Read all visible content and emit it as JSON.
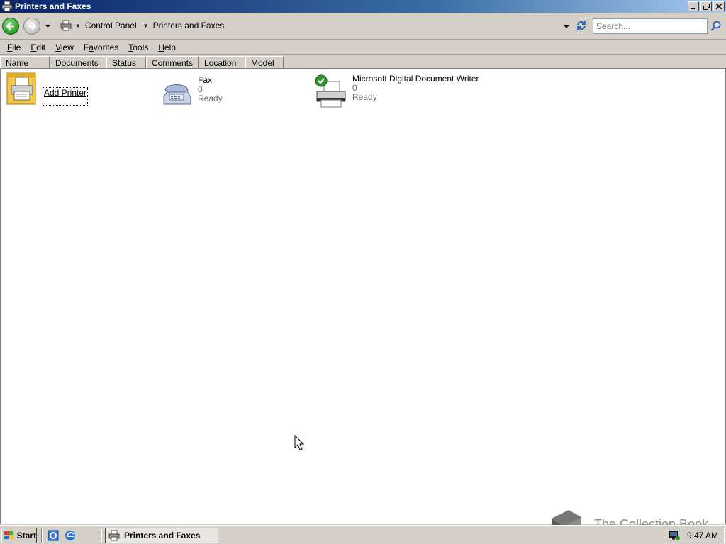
{
  "window": {
    "title": "Printers and Faxes"
  },
  "address": {
    "breadcrumbs": [
      "Control Panel",
      "Printers and Faxes"
    ],
    "search_placeholder": "Search..."
  },
  "menu": [
    {
      "pre": "",
      "ul": "F",
      "post": "ile"
    },
    {
      "pre": "",
      "ul": "E",
      "post": "dit"
    },
    {
      "pre": "",
      "ul": "V",
      "post": "iew"
    },
    {
      "pre": "F",
      "ul": "a",
      "post": "vorites"
    },
    {
      "pre": "",
      "ul": "T",
      "post": "ools"
    },
    {
      "pre": "",
      "ul": "H",
      "post": "elp"
    }
  ],
  "columns": [
    "Name",
    "Documents",
    "Status",
    "Comments",
    "Location",
    "Model"
  ],
  "items": {
    "add_printer": {
      "label": "Add Printer"
    },
    "fax": {
      "name": "Fax",
      "documents": "0",
      "status": "Ready"
    },
    "mddw": {
      "name": "Microsoft Digital Document Writer",
      "documents": "0",
      "status": "Ready",
      "is_default": true
    }
  },
  "taskbar": {
    "start_label": "Start",
    "task_label": "Printers and Faxes",
    "clock": "9:47 AM"
  },
  "watermark": {
    "text": "The Collection Book"
  },
  "colors": {
    "title_bar": "#0a246a",
    "window_bg": "#d4d0c8",
    "content_bg": "#ffffff"
  }
}
